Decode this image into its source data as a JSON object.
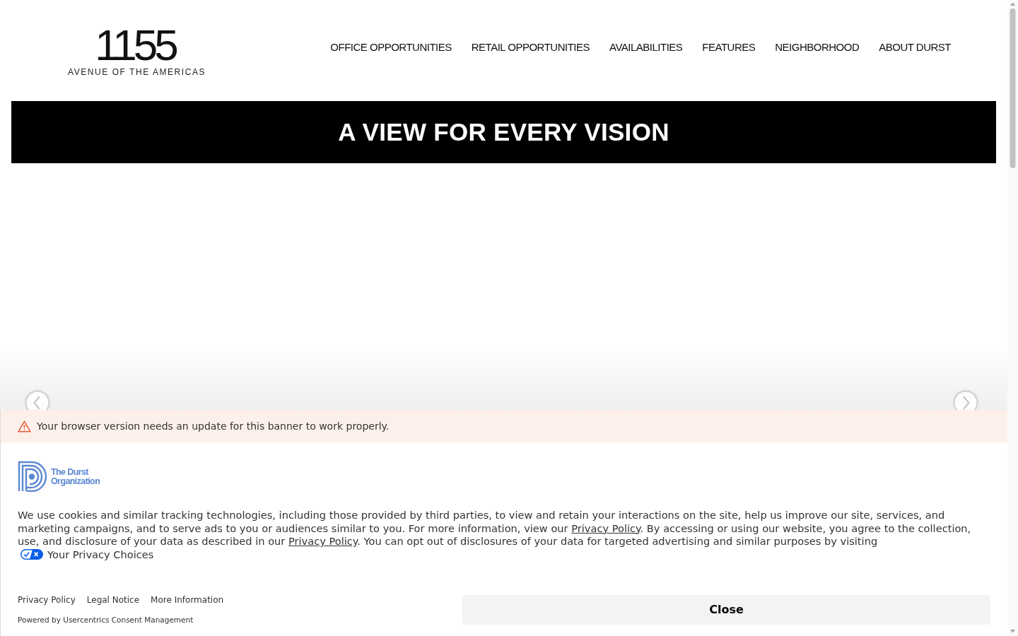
{
  "logo": {
    "number": "1155",
    "tagline": "AVENUE OF THE AMERICAS"
  },
  "nav": [
    "OFFICE OPPORTUNITIES",
    "RETAIL OPPORTUNITIES",
    "AVAILABILITIES",
    "FEATURES",
    "NEIGHBORHOOD",
    "ABOUT DURST"
  ],
  "hero": {
    "title": "A VIEW FOR EVERY VISION"
  },
  "consent_banner": {
    "warning": "Your browser version needs an update for this banner to work properly.",
    "brand": {
      "lines": [
        "The Durst",
        "Organization"
      ]
    },
    "message": [
      {
        "kind": "text",
        "text": "We use cookies and similar tracking technologies, including those provided by third parties, to view and retain your interactions on the site, help us improve our site, services, and marketing campaigns, and to serve ads to you or audiences similar to you. For more information, view our "
      },
      {
        "kind": "link",
        "text": "Privacy Policy"
      },
      {
        "kind": "text",
        "text": ". By accessing or using our website, you agree to the collection, use, and disclosure of your data as described in our "
      },
      {
        "kind": "link",
        "text": "Privacy Policy"
      },
      {
        "kind": "text",
        "text": ". You can opt out of disclosures of your data for targeted advertising and similar purposes by visiting "
      },
      {
        "kind": "choices_link",
        "text": "Your Privacy Choices"
      }
    ],
    "footer_links": [
      "Privacy Policy",
      "Legal Notice",
      "More Information"
    ],
    "powered_by": "Powered by Usercentrics Consent Management",
    "close_button": "Close"
  }
}
